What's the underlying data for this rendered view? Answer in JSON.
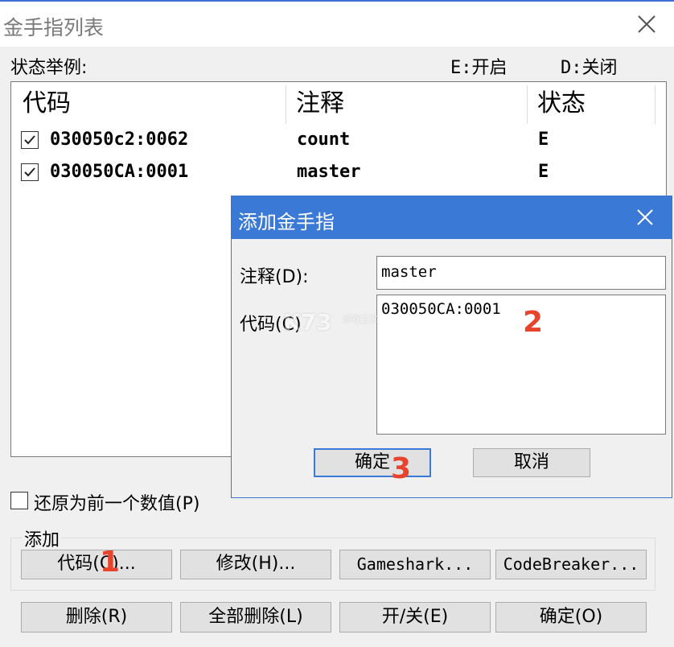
{
  "window": {
    "title": "金手指列表"
  },
  "legend": {
    "label": "状态举例:",
    "enabled": "E:开启",
    "disabled": "D:关闭"
  },
  "list": {
    "columns": [
      "代码",
      "注释",
      "状态"
    ],
    "rows": [
      {
        "checked": true,
        "code": "030050c2:0062",
        "note": "count",
        "state": "E"
      },
      {
        "checked": true,
        "code": "030050CA:0001",
        "note": "master",
        "state": "E"
      }
    ]
  },
  "restore_checkbox": {
    "label": "还原为前一个数值(P)",
    "checked": false
  },
  "add_group": {
    "label": "添加",
    "buttons": [
      "代码(C)...",
      "修改(H)...",
      "Gameshark...",
      "CodeBreaker..."
    ]
  },
  "bottom_buttons": [
    "删除(R)",
    "全部删除(L)",
    "开/关(E)",
    "确定(O)"
  ],
  "dialog": {
    "title": "添加金手指",
    "note_label": "注释(D):",
    "note_value": "master",
    "code_label": "代码(C)",
    "code_value": "030050CA:0001",
    "ok_label": "确定",
    "cancel_label": "取消"
  },
  "annotations": [
    "1",
    "2",
    "3"
  ],
  "watermark": {
    "logo": "K73",
    "text": "游戏之家"
  },
  "colors": {
    "dialog_titlebar": "#3a79d6",
    "annotation": "#e8432b",
    "window_bg": "#f0f0f0"
  }
}
